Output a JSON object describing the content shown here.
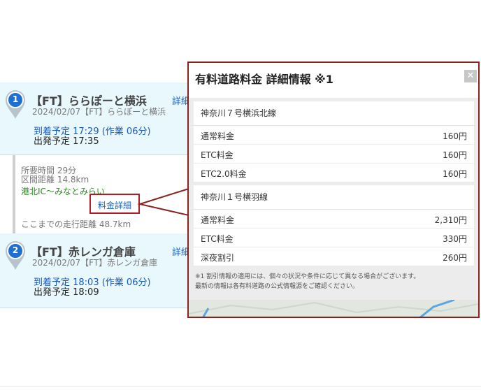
{
  "stops": [
    {
      "number": "1",
      "name": "【FT】ららぽーと横浜",
      "subtitle": "2024/02/07【FT】ららぽーと横浜",
      "detail_link": "詳細",
      "arrive": "到着予定 17:29 (作業 06分)",
      "depart": "出発予定 17:35"
    },
    {
      "number": "2",
      "name": "【FT】赤レンガ倉庫",
      "subtitle": "2024/02/07【FT】赤レンガ倉庫",
      "detail_link": "詳細",
      "arrive": "到着予定 18:03 (作業 06分)",
      "depart": "出発予定 18:09"
    }
  ],
  "segment": {
    "duration": "所要時間 29分",
    "distance": "区間距離 14.8km",
    "road": "港北IC〜みなとみらい",
    "toll_link": "料金詳細",
    "total": "ここまでの走行距離 48.7km"
  },
  "modal": {
    "title": "有料道路料金 詳細情報 ※1",
    "close_icon": "close-icon",
    "sections": [
      {
        "name": "神奈川７号横浜北線",
        "rows": [
          {
            "label": "通常料金",
            "value": "160円"
          },
          {
            "label": "ETC料金",
            "value": "160円"
          },
          {
            "label": "ETC2.0料金",
            "value": "160円"
          }
        ]
      },
      {
        "name": "神奈川１号横羽線",
        "rows": [
          {
            "label": "通常料金",
            "value": "2,310円"
          },
          {
            "label": "ETC料金",
            "value": "330円"
          },
          {
            "label": "深夜割引",
            "value": "260円"
          }
        ]
      }
    ],
    "note_line1": "※1 割引情報の適用には、個々の状況や条件に応じて異なる場合がございます。",
    "note_line2": "最新の情報は各有料道路の公式情報源をご確認ください。"
  },
  "colors": {
    "card_bg": "#e9f8fd",
    "pin": "#1f6ed1",
    "highlight": "#b01c24",
    "link": "#1c5fb8"
  }
}
